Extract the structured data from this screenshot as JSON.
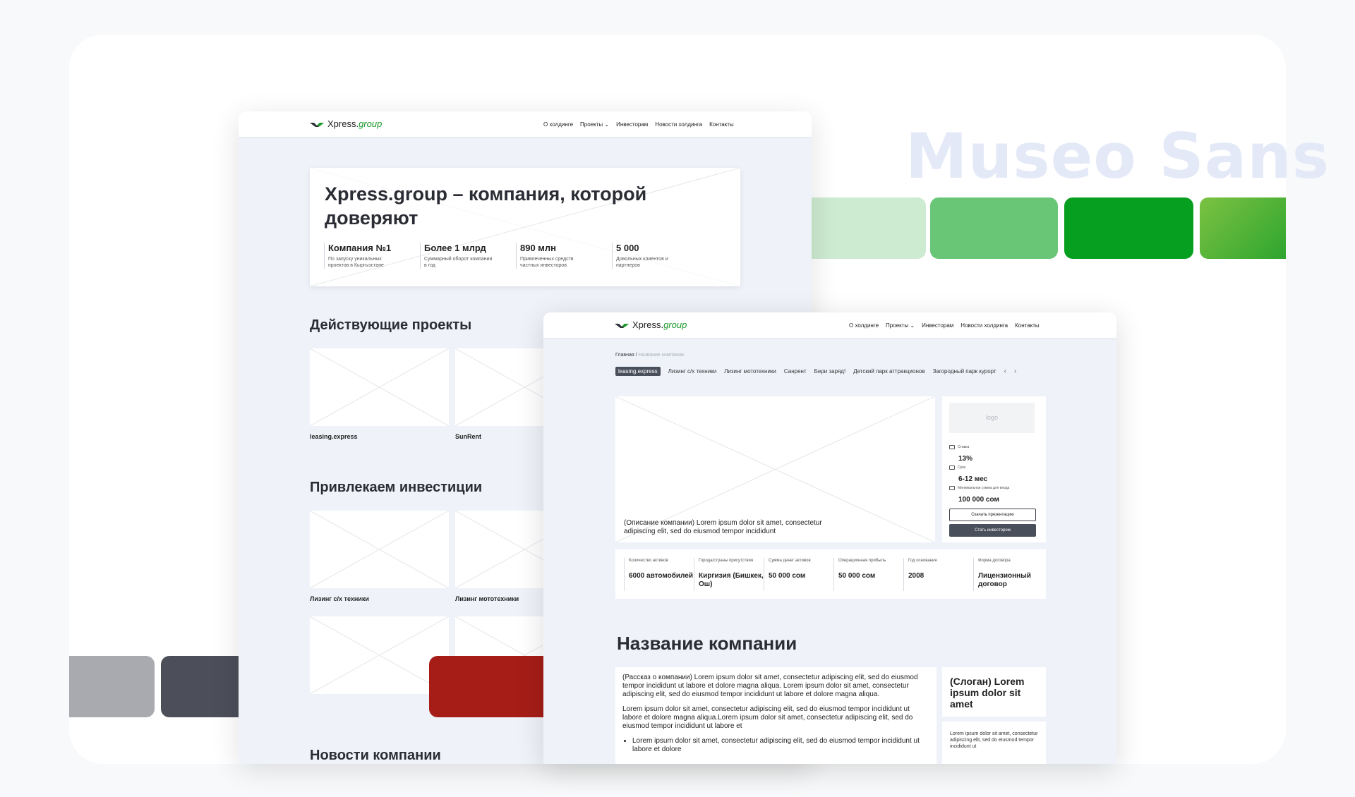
{
  "font_name": "Museo Sans",
  "colors": {
    "background": "#f8f9fa",
    "card": "#ffffff",
    "font_title": "#e3e9f7",
    "greens": [
      "#cdebd1",
      "#69c677",
      "#069f20",
      "#4cae3a"
    ],
    "neutrals": [
      "#a9aab0",
      "#4c4e5a",
      "#25262d",
      "#a61d17"
    ],
    "screen_bg": "#eff3f9",
    "accent_green": "#1a9a2a"
  },
  "brand": {
    "name": "Xpress.",
    "suffix": "group"
  },
  "nav": [
    "О холдинге",
    "Проекты",
    "Инвесторам",
    "Новости холдинга",
    "Контакты"
  ],
  "home": {
    "hero_title": "Xpress.group – компания, которой доверяют",
    "stats": [
      {
        "value": "Компания №1",
        "label": "По запуску уникальных проектов в Кыргызстане"
      },
      {
        "value": "Более 1 млрд",
        "label": "Суммарный оборот компании в год"
      },
      {
        "value": "890 млн",
        "label": "Привлеченных средств частных инвесторов"
      },
      {
        "value": "5 000",
        "label": "Довольных клиентов и партнеров"
      }
    ],
    "section_projects": "Действующие проекты",
    "projects": [
      "leasing.express",
      "SunRent"
    ],
    "section_invest": "Привлекаем инвестиции",
    "invest": [
      "Лизинг с/х техники",
      "Лизинг мототехники"
    ],
    "section_news": "Новости компании"
  },
  "company": {
    "breadcrumb_home": "Главная",
    "breadcrumb_sep": "/",
    "breadcrumb_current": "Название компании",
    "chips": [
      "leasing.express",
      "Лизинг с/х техники",
      "Лизинг мототехники",
      "Санрент",
      "Бери заряд!",
      "Детский парк аттракционов",
      "Загородный парк курорт"
    ],
    "media_description": "(Описание компании) Lorem ipsum dolor sit amet, consectetur adipiscing elit, sed do eiusmod tempor incididunt",
    "logo_placeholder": "logo",
    "rate_label": "Ставка",
    "rate_value": "13%",
    "term_label": "Срок",
    "term_value": "6-12 мес",
    "min_label": "Минимальная сумма для входа",
    "min_value": "100 000 сом",
    "btn_download": "Скачать презентацию",
    "btn_invest": "Стать инвестором",
    "facts": [
      {
        "label": "Количество активов",
        "value": "6000 автомобилей"
      },
      {
        "label": "Города/страны присутствия",
        "value": "Киргизия (Бишкек, Ош)"
      },
      {
        "label": "Сумма денег активов",
        "value": "50 000 сом"
      },
      {
        "label": "Операционная прибыль",
        "value": "50 000 сом"
      },
      {
        "label": "Год основания",
        "value": "2008"
      },
      {
        "label": "Форма договора",
        "value": "Лицензионный договор"
      }
    ],
    "title": "Название компании",
    "story_1": "(Рассказ о компании) Lorem ipsum dolor sit amet, consectetur adipiscing elit, sed do eiusmod tempor incididunt ut labore et dolore magna aliqua. Lorem ipsum dolor sit amet, consectetur adipiscing elit, sed do eiusmod tempor incididunt ut labore et dolore magna aliqua.",
    "story_2": "Lorem ipsum dolor sit amet, consectetur adipiscing elit, sed do eiusmod tempor incididunt ut labore et dolore magna aliqua.Lorem ipsum dolor sit amet, consectetur adipiscing elit, sed do eiusmod tempor incididunt ut labore et",
    "story_bullet": "Lorem ipsum dolor sit amet, consectetur adipiscing elit, sed do eiusmod tempor incididunt ut labore et dolore",
    "slogan": "(Слоган) Lorem ipsum dolor sit amet",
    "slogan_text": "Lorem ipsum dolor sit amet, consectetur adipiscing elit, sed do eiusmod tempor incididunt ut"
  }
}
